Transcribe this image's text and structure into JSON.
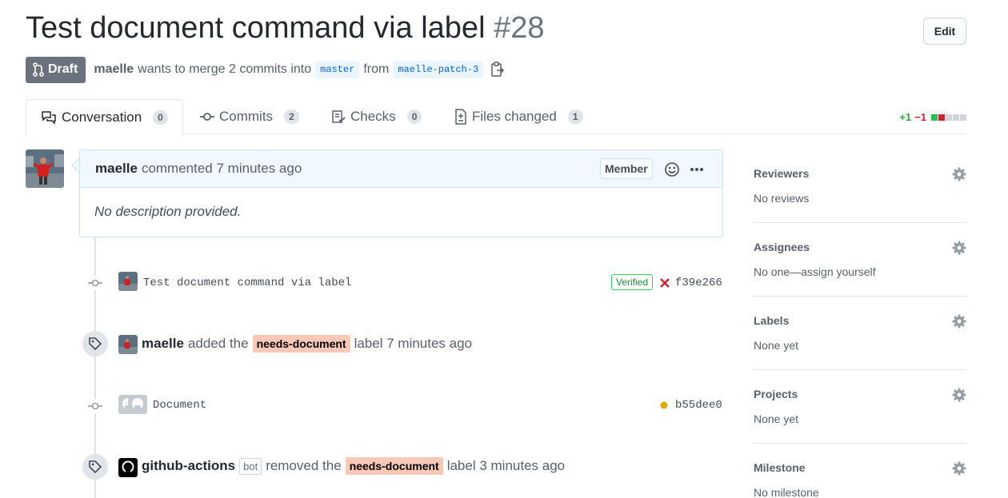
{
  "header": {
    "title": "Test document command via label",
    "number": "#28",
    "edit_label": "Edit"
  },
  "meta": {
    "status": "Draft",
    "author": "maelle",
    "text_merge": "wants to merge 2 commits into",
    "base_branch": "master",
    "text_from": "from",
    "head_branch": "maelle-patch-3"
  },
  "tabs": [
    {
      "label": "Conversation",
      "count": "0",
      "icon": "conversation-icon"
    },
    {
      "label": "Commits",
      "count": "2",
      "icon": "commit-icon"
    },
    {
      "label": "Checks",
      "count": "0",
      "icon": "checks-icon"
    },
    {
      "label": "Files changed",
      "count": "1",
      "icon": "file-diff-icon"
    }
  ],
  "diffstat": {
    "additions": "+1",
    "deletions": "−1"
  },
  "comment": {
    "author": "maelle",
    "action": "commented",
    "time": "7 minutes ago",
    "role": "Member",
    "body": "No description provided."
  },
  "timeline": {
    "commit1": {
      "message": "Test document command via label",
      "verified": "Verified",
      "sha": "f39e266",
      "status_color": "#cb2431"
    },
    "event1": {
      "actor": "maelle",
      "action": "added the",
      "label": "needs-document",
      "suffix": "label 7 minutes ago"
    },
    "commit2": {
      "message": "Document",
      "sha": "b55dee0",
      "status_color": "#dbab09"
    },
    "event2": {
      "actor": "github-actions",
      "bot": "bot",
      "action": "removed the",
      "label": "needs-document",
      "suffix": "label 3 minutes ago"
    }
  },
  "sidebar": [
    {
      "title": "Reviewers",
      "value": "No reviews"
    },
    {
      "title": "Assignees",
      "value": "No one—assign yourself"
    },
    {
      "title": "Labels",
      "value": "None yet"
    },
    {
      "title": "Projects",
      "value": "None yet"
    },
    {
      "title": "Milestone",
      "value": "No milestone"
    }
  ],
  "colors": {
    "label_bg": "#f9c8b6",
    "draft": "#6a737d",
    "link": "#0366d6"
  }
}
